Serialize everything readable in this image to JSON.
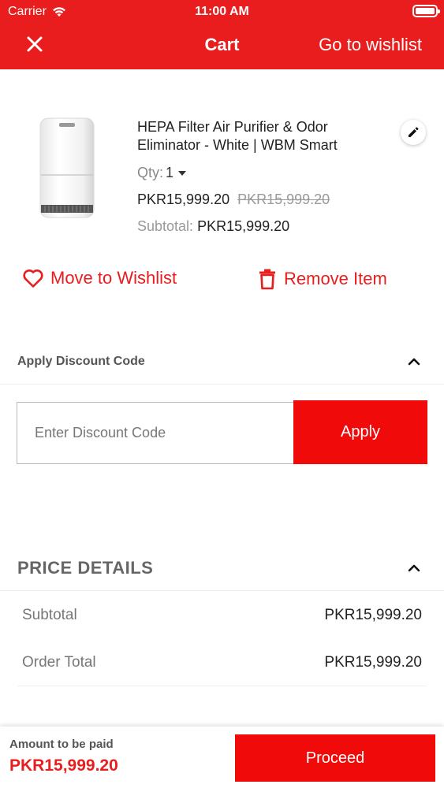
{
  "status_bar": {
    "carrier": "Carrier",
    "time": "11:00 AM"
  },
  "nav": {
    "title": "Cart",
    "wishlist_link": "Go to wishlist",
    "close_icon": "close-icon"
  },
  "product": {
    "name": "HEPA Filter Air Purifier & Odor Eliminator - White | WBM Smart",
    "qty_label": "Qty:",
    "qty_value": "1",
    "price": "PKR15,999.20",
    "original_price": "PKR15,999.20",
    "subtotal_label": "Subtotal:",
    "subtotal_value": "PKR15,999.20",
    "edit_icon": "pencil-icon"
  },
  "actions": {
    "move_to_wishlist": "Move to Wishlist",
    "remove_item": "Remove Item"
  },
  "discount": {
    "title": "Apply Discount Code",
    "placeholder": "Enter Discount Code",
    "apply_label": "Apply"
  },
  "price_details": {
    "title": "PRICE DETAILS",
    "subtotal_label": "Subtotal",
    "subtotal_value": "PKR15,999.20",
    "order_total_label": "Order Total",
    "order_total_value": "PKR15,999.20"
  },
  "footer": {
    "amount_label": "Amount to be paid",
    "amount_value": "PKR15,999.20",
    "proceed_label": "Proceed"
  },
  "colors": {
    "brand_red": "#e91d1d",
    "button_red": "#f00a0a"
  }
}
